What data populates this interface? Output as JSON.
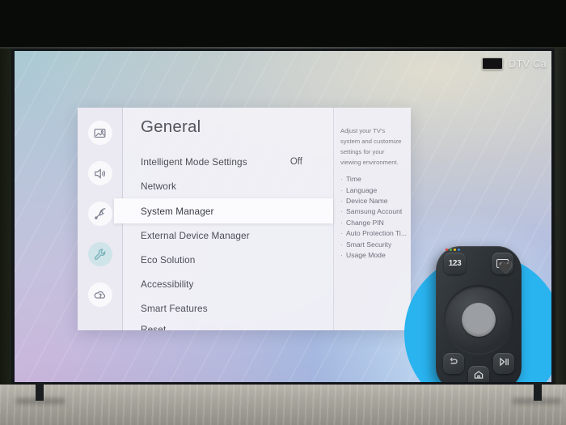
{
  "channel_banner": {
    "label": "DTV Ca",
    "thumb_icon": "tv-thumbnail-icon"
  },
  "panel": {
    "title": "General",
    "sidebar": [
      {
        "name": "picture",
        "icon": "picture-icon",
        "selected": false
      },
      {
        "name": "sound",
        "icon": "speaker-icon",
        "selected": false
      },
      {
        "name": "broadcasting",
        "icon": "antenna-icon",
        "selected": false
      },
      {
        "name": "general",
        "icon": "wrench-icon",
        "selected": true
      },
      {
        "name": "support",
        "icon": "support-cloud-icon",
        "selected": false
      }
    ],
    "rows": [
      {
        "label": "Intelligent Mode Settings",
        "value": "Off",
        "selected": false,
        "clipped": false
      },
      {
        "label": "Network",
        "value": "",
        "selected": false,
        "clipped": false
      },
      {
        "label": "System Manager",
        "value": "",
        "selected": true,
        "clipped": false
      },
      {
        "label": "External Device Manager",
        "value": "",
        "selected": false,
        "clipped": false
      },
      {
        "label": "Eco Solution",
        "value": "",
        "selected": false,
        "clipped": false
      },
      {
        "label": "Accessibility",
        "value": "",
        "selected": false,
        "clipped": false
      },
      {
        "label": "Smart Features",
        "value": "",
        "selected": false,
        "clipped": false
      },
      {
        "label": "Reset",
        "value": "",
        "selected": false,
        "clipped": true
      }
    ],
    "description": {
      "text": "Adjust your TV's system and customize settings for your viewing environment.",
      "items": [
        "Time",
        "Language",
        "Device Name",
        "Samsung Account",
        "Change PIN",
        "Auto Protection Ti...",
        "Smart Security",
        "Usage Mode"
      ]
    }
  },
  "remote": {
    "keypad_label": "123",
    "keypad_dots": [
      "#e03b36",
      "#4caf50",
      "#f2c21c",
      "#3a8ee0"
    ],
    "buttons": [
      {
        "name": "keypad-123-button"
      },
      {
        "name": "closed-caption-button"
      },
      {
        "name": "directional-pad"
      },
      {
        "name": "back-button"
      },
      {
        "name": "home-button"
      },
      {
        "name": "play-pause-button"
      }
    ]
  },
  "colors": {
    "spotlight": "#29b3ef",
    "accent_selected_icon": "#cfe4e8",
    "panel_bg": "#f3f2f7",
    "selected_row_bg": "#fbfbfd"
  }
}
